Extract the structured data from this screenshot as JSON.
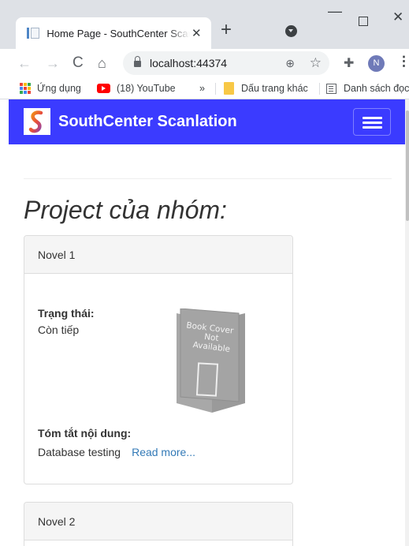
{
  "browser": {
    "tab_title": "Home Page - SouthCenter Scanlation",
    "url": "localhost:44374",
    "avatar_letter": "N",
    "bookmarks": [
      {
        "label": "Ứng dụng"
      },
      {
        "label": "(18) YouTube"
      },
      {
        "label": "»"
      },
      {
        "label": "Dấu trang khác"
      },
      {
        "label": "Danh sách đọc"
      }
    ]
  },
  "site": {
    "brand": "SouthCenter Scanlation",
    "accent_color": "#3b3bff",
    "section_title": "Project của nhóm:",
    "projects": [
      {
        "name": "Novel 1",
        "status_label": "Trạng thái:",
        "status_value": "Còn tiếp",
        "cover_text": [
          "Book Cover",
          "Not",
          "Available"
        ],
        "summary_label": "Tóm tắt nội dung:",
        "summary_value": "Database testing",
        "read_more": "Read more..."
      },
      {
        "name": "Novel 2"
      }
    ]
  }
}
